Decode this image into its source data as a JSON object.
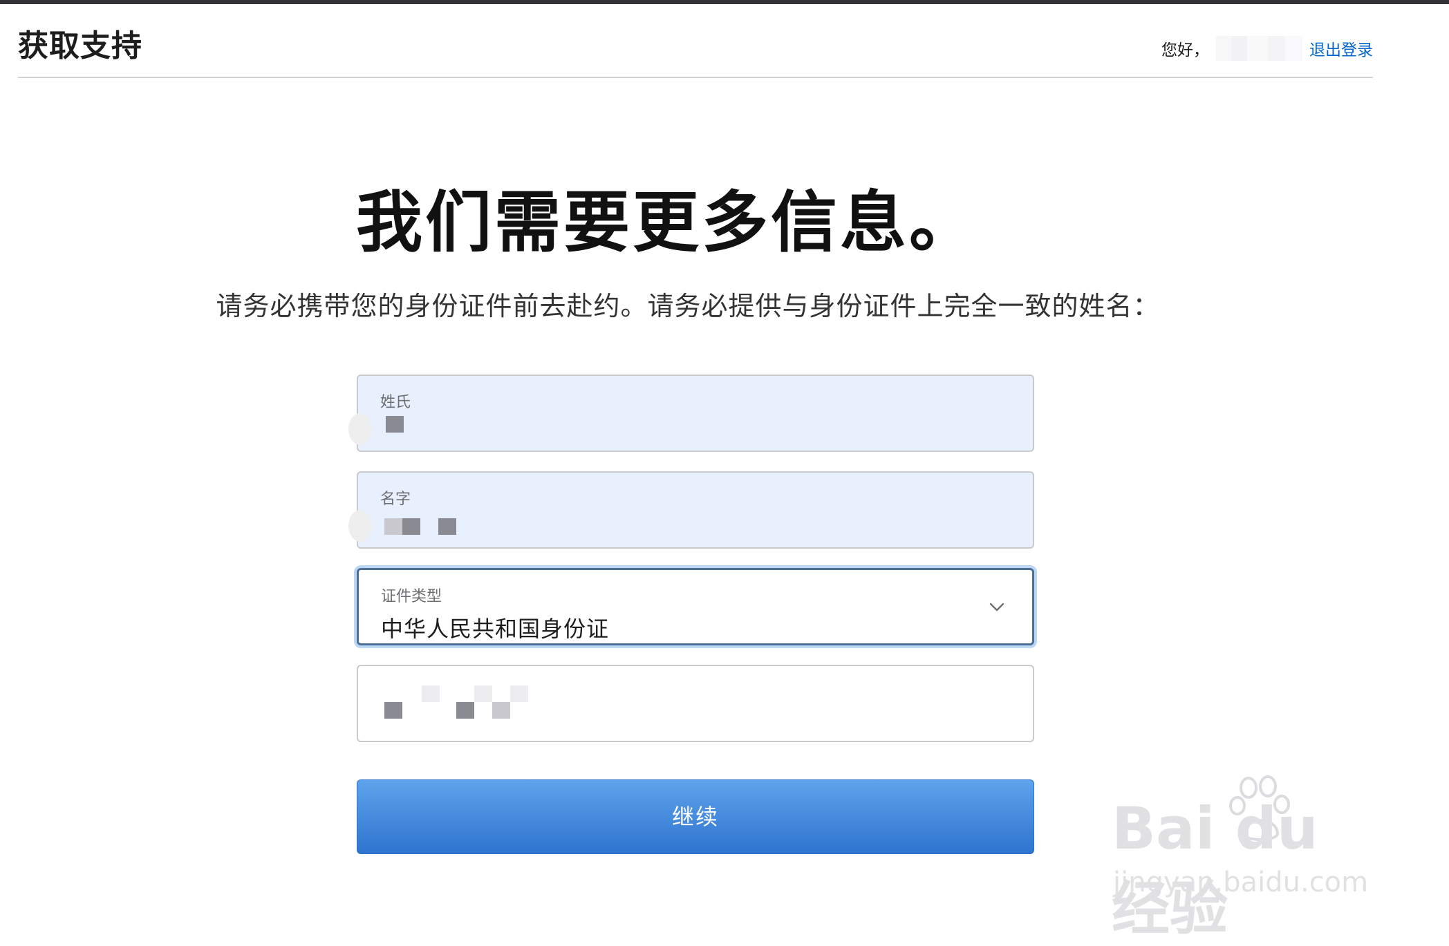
{
  "header": {
    "brand": "获取支持",
    "greeting": "您好，",
    "logout_label": "退出登录"
  },
  "main": {
    "title": "我们需要更多信息。",
    "subtitle": "请务必携带您的身份证件前去赴约。请务必提供与身份证件上完全一致的姓名："
  },
  "form": {
    "last_name": {
      "label": "姓氏",
      "value": ""
    },
    "first_name": {
      "label": "名字",
      "value": ""
    },
    "id_type": {
      "label": "证件类型",
      "value": "中华人民共和国身份证"
    },
    "id_number": {
      "value": ""
    },
    "continue_label": "继续"
  },
  "watermark": {
    "main": "Bai du 经验",
    "sub": "jingyan.baidu.com"
  },
  "colors": {
    "accent_link": "#0066cc",
    "button_top": "#5ea3eb",
    "button_bottom": "#2f74cf",
    "autofill_bg": "#e8f0fe",
    "focus_border": "#4c6e95"
  }
}
